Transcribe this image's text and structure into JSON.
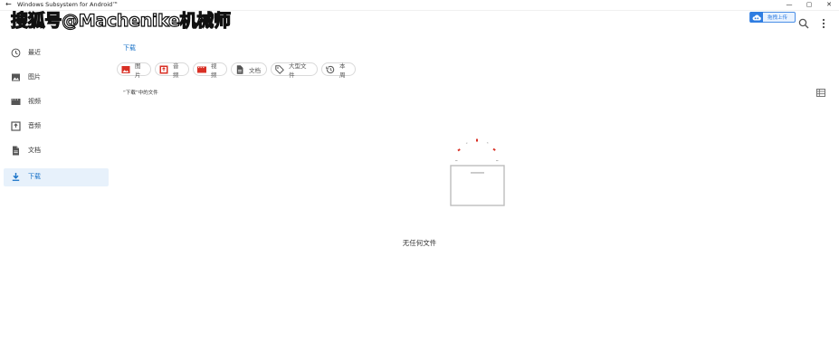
{
  "window": {
    "title": "Windows Subsystem for Android™",
    "controls": [
      "—",
      "▢",
      "✕"
    ]
  },
  "watermark": "搜狐号@Machenike机械师",
  "header": {
    "upload_label": "拖拽上传",
    "icons": [
      "search-icon",
      "more-vert-icon"
    ]
  },
  "sidebar": {
    "items": [
      {
        "label": "最近",
        "icon": "clock-icon",
        "active": false
      },
      {
        "label": "图片",
        "icon": "image-icon",
        "active": false
      },
      {
        "label": "视频",
        "icon": "film-icon",
        "active": false
      },
      {
        "label": "音频",
        "icon": "audio-icon",
        "active": false
      },
      {
        "label": "文档",
        "icon": "document-icon",
        "active": false
      },
      {
        "label": "下载",
        "icon": "download-icon",
        "active": true
      }
    ]
  },
  "main": {
    "breadcrumb": "下载",
    "chips": [
      {
        "label": "图片",
        "icon": "image-icon"
      },
      {
        "label": "音频",
        "icon": "audio-icon"
      },
      {
        "label": "视频",
        "icon": "film-icon"
      },
      {
        "label": "文档",
        "icon": "document-icon"
      },
      {
        "label": "大型文件",
        "icon": "tag-icon"
      },
      {
        "label": "本周",
        "icon": "history-icon"
      }
    ],
    "section_label": "“下载”中的文件",
    "empty_text": "无任何文件"
  },
  "colors": {
    "accent": "#1a73c8",
    "active_bg": "#e7f1fb",
    "chip_icon_red": "#d93025",
    "badge_blue": "#2f7de1"
  }
}
